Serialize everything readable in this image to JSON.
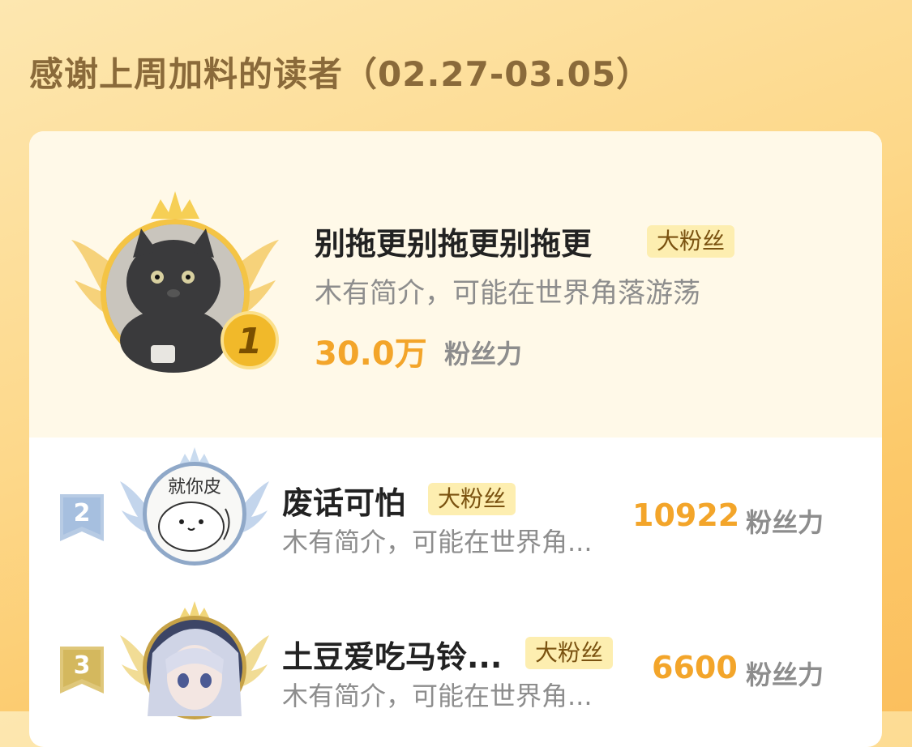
{
  "header": {
    "title": "感谢上周加料的读者（02.27-03.05）"
  },
  "colors": {
    "accent": "#f3a52a",
    "gold": "#f5c43a",
    "silver": "#9db6d6",
    "bronze": "#d9b85a"
  },
  "readers": [
    {
      "rank": "1",
      "name": "别拖更别拖更别拖更",
      "badge": "大粉丝",
      "intro": "木有简介，可能在世界角落游荡",
      "value": "30.0万",
      "unit": "粉丝力",
      "avatar_icon": "cat-photo-avatar"
    },
    {
      "rank": "2",
      "name": "废话可怕",
      "badge": "大粉丝",
      "intro": "木有简介，可能在世界角...",
      "value": "10922",
      "unit": "粉丝力",
      "avatar_icon": "cartoon-bun-avatar",
      "avatar_text": "就你皮"
    },
    {
      "rank": "3",
      "name": "土豆爱吃马铃...",
      "badge": "大粉丝",
      "intro": "木有简介，可能在世界角...",
      "value": "6600",
      "unit": "粉丝力",
      "avatar_icon": "anime-character-avatar"
    }
  ]
}
